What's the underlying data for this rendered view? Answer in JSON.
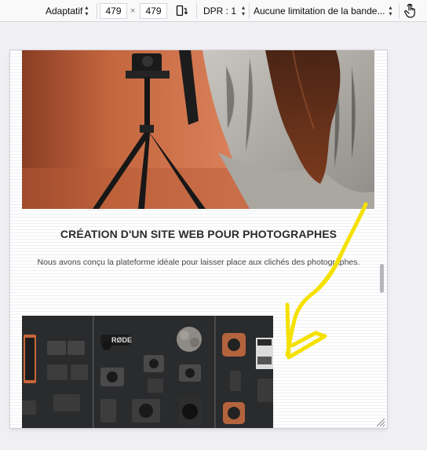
{
  "toolbar": {
    "device_select": "Adaptatif",
    "width_value": "479",
    "height_value": "479",
    "times_symbol": "×",
    "dpr_select": "DPR : 1",
    "throttle_select": "Aucune limitation de la bande..."
  },
  "page": {
    "title": "CRÉATION D'UN SITE WEB POUR PHOTOGRAPHES",
    "description": "Nous avons conçu la plateforme idéale pour laisser place aux clichés des photographes."
  },
  "icons": {
    "rotate": "rotate-device-icon",
    "touch": "touch-simulation-icon",
    "resize": "resize-grip-icon"
  },
  "colors": {
    "annotation": "#f5e100",
    "toolbar_bg": "#f9f9fa"
  }
}
